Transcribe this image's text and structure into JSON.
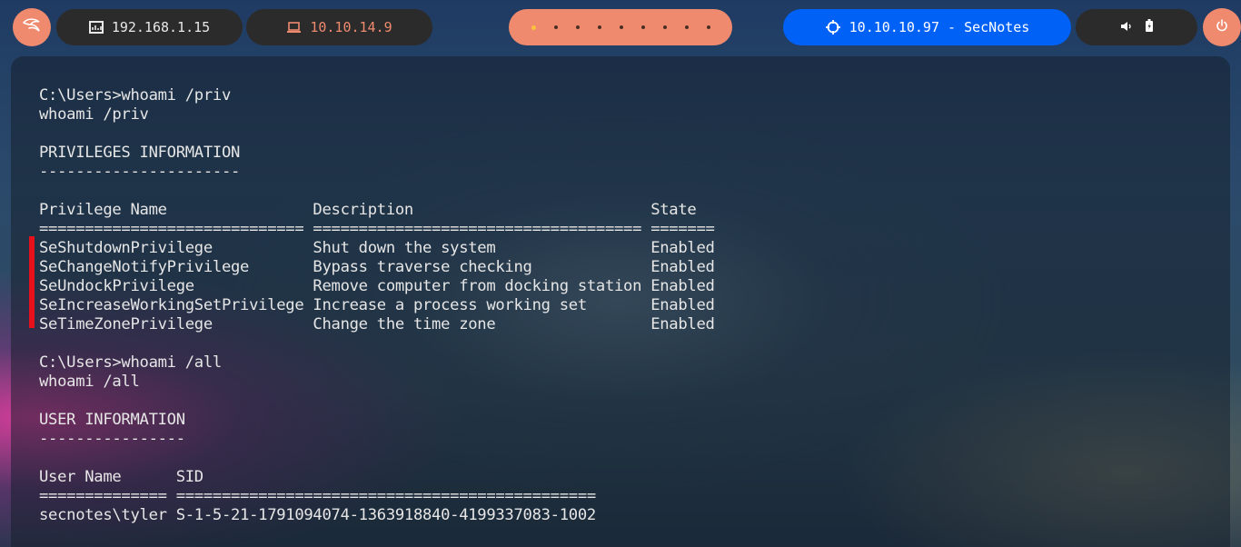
{
  "topbar": {
    "local_ip": "192.168.1.15",
    "vpn_ip": "10.10.14.9",
    "target": "10.10.10.97 - SecNotes",
    "workspace_count": 9,
    "active_workspace": 1,
    "icons": {
      "menu": "kali-dragon-icon",
      "local": "monitor-icon",
      "vpn": "laptop-icon",
      "target": "crosshair-icon",
      "volume": "speaker-icon",
      "battery": "battery-icon",
      "power": "power-icon"
    },
    "colors": {
      "accent": "#f08a6e",
      "target_bg": "#0061f7",
      "pill_bg": "#2b2b2b"
    }
  },
  "terminal": {
    "lines": [
      "C:\\Users>whoami /priv",
      "whoami /priv",
      "",
      "PRIVILEGES INFORMATION",
      "----------------------",
      "",
      "Privilege Name                Description                          State",
      "============================= ==================================== =======",
      "SeShutdownPrivilege           Shut down the system                 Enabled",
      "SeChangeNotifyPrivilege       Bypass traverse checking             Enabled",
      "SeUndockPrivilege             Remove computer from docking station Enabled",
      "SeIncreaseWorkingSetPrivilege Increase a process working set       Enabled",
      "SeTimeZonePrivilege           Change the time zone                 Enabled",
      "",
      "C:\\Users>whoami /all",
      "whoami /all",
      "",
      "USER INFORMATION",
      "----------------",
      "",
      "User Name      SID",
      "============== ==============================================",
      "secnotes\\tyler S-1-5-21-1791094074-1363918840-4199337083-1002"
    ]
  }
}
